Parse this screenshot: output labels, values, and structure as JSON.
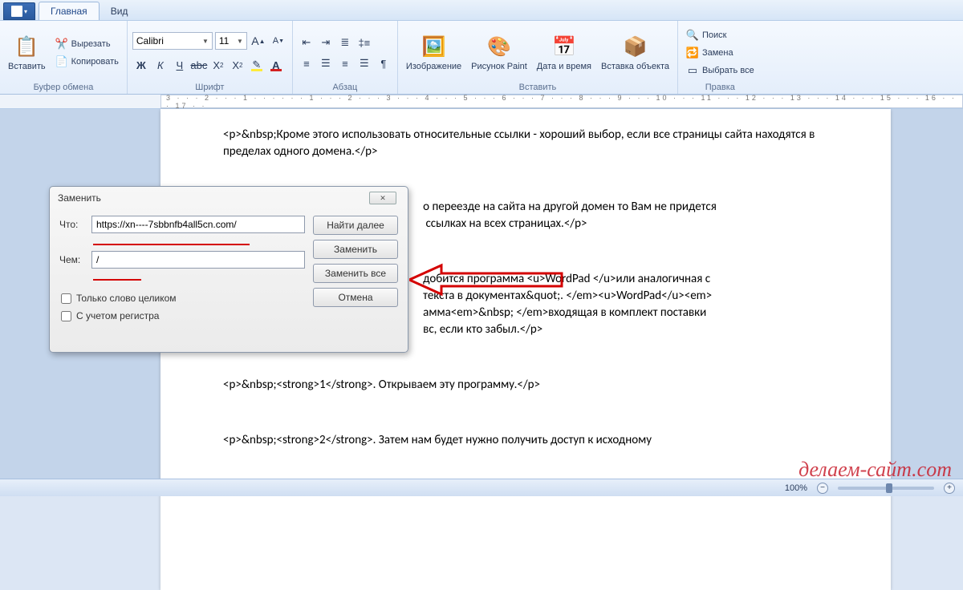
{
  "tabs": {
    "main": "Главная",
    "view": "Вид"
  },
  "clipboard": {
    "title": "Буфер обмена",
    "paste": "Вставить",
    "cut": "Вырезать",
    "copy": "Копировать"
  },
  "font": {
    "title": "Шрифт",
    "family": "Calibri",
    "size": "11"
  },
  "paragraph": {
    "title": "Абзац"
  },
  "insert": {
    "title": "Вставить",
    "image": "Изображение",
    "paint": "Рисунок Paint",
    "datetime": "Дата и время",
    "object": "Вставка объекта"
  },
  "editing": {
    "title": "Правка",
    "find": "Поиск",
    "replace": "Замена",
    "selectall": "Выбрать все"
  },
  "ruler_marks": "3 · · · 2 · · · 1 · · · · · · 1 · · · 2 · · · 3 · · · 4 · · · 5 · · · 6 · · · 7 · · · 8 · · · 9 · · · 10 · · · 11 · · · 12 · · · 13 · · · 14 · · · 15 · · · 16 · · · 17 · ·",
  "document": {
    "p1": "<p>&nbsp;Кроме этого использовать относительные ссылки - хороший выбор, если все страницы сайта находятся в пределах одного домена.</p>",
    "p2a": "о переезде на сайта на другой домен то Вам не придется",
    "p2b": " ссылках на всех страницах.</p>",
    "p3a": "добится программа <u>WordPad </u>или аналогичная с",
    "p3b": "текста в документах&quot;. </em><u>WordPad</u><em>",
    "p3c": "амма<em>&nbsp; </em>входящая в комплект поставки",
    "p3d": "вс, если кто забыл.</p>",
    "p4": "<p>&nbsp;<strong>1</strong>. Открываем эту программу.</p>",
    "p5": "<p>&nbsp;<strong>2</strong>. Затем нам будет нужно получить доступ к исходному"
  },
  "dialog": {
    "title": "Заменить",
    "what_lbl": "Что:",
    "what_val": "https://xn----7sbbnfb4all5cn.com/",
    "with_lbl": "Чем:",
    "with_val": "/",
    "whole_word": "Только слово целиком",
    "match_case": "С учетом регистра",
    "find_next": "Найти далее",
    "replace": "Заменить",
    "replace_all": "Заменить все",
    "cancel": "Отмена"
  },
  "status": {
    "zoom": "100%"
  },
  "watermark": "делаем-сайт.com"
}
